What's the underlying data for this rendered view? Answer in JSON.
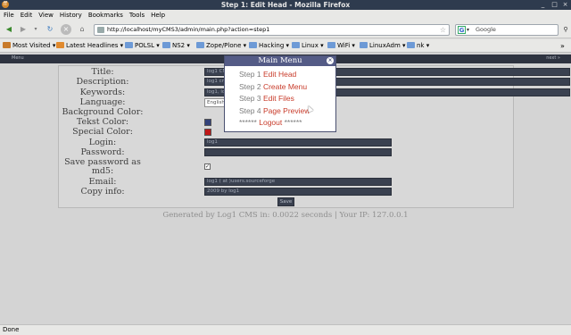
{
  "window": {
    "title": "Step 1: Edit Head - Mozilla Firefox"
  },
  "menu": [
    "File",
    "Edit",
    "View",
    "History",
    "Bookmarks",
    "Tools",
    "Help"
  ],
  "nav": {
    "url": "http://localhost/myCMS3/admin/main.php?action=step1",
    "search_placeholder": "Google"
  },
  "bookmarks": [
    {
      "label": "Most Visited",
      "has_menu": true
    },
    {
      "label": "Latest Headlines",
      "has_menu": true
    },
    {
      "label": "POLSL",
      "has_menu": true
    },
    {
      "label": "NS2",
      "has_menu": true
    },
    {
      "label": "Zope/Plone",
      "has_menu": true
    },
    {
      "label": "Hacking",
      "has_menu": true
    },
    {
      "label": "Linux",
      "has_menu": true
    },
    {
      "label": "WiFi",
      "has_menu": true
    },
    {
      "label": "LinuxAdm",
      "has_menu": true
    },
    {
      "label": "nk",
      "has_menu": true
    }
  ],
  "topstrip": {
    "left": "Menu",
    "right": "next »"
  },
  "form": {
    "labels": {
      "title": "Title:",
      "description": "Description:",
      "keywords": "Keywords:",
      "language": "Language:",
      "background_color": "Background Color:",
      "text_color": "Tekst Color:",
      "special_color": "Special Color:",
      "login": "Login:",
      "password": "Password:",
      "save_password_1": "Save password as",
      "save_password_2": "md5:",
      "email": "Email:",
      "copy_info": "Copy info:"
    },
    "values": {
      "title": "log1 CMS",
      "description": "log1 cms offical page",
      "keywords": "log1, log 1, CMS, content managment system",
      "language": "English",
      "login": "log1",
      "password": "",
      "email": "log1 ( at )users.sourceforge",
      "copy_info": "2009 by log1"
    },
    "save_button": "Save",
    "colors": {
      "text_color": "#33427a",
      "special_color": "#c01818"
    }
  },
  "footer": "Generated by Log1 CMS in: 0.0022 seconds | Your IP: 127.0.0.1",
  "modal": {
    "title": "Main Menu",
    "close_symbol": "×",
    "steps": [
      {
        "prefix": "Step 1",
        "label": "Edit Head"
      },
      {
        "prefix": "Step 2",
        "label": "Create Menu"
      },
      {
        "prefix": "Step 3",
        "label": "Edit Files"
      },
      {
        "prefix": "Step 4",
        "label": "Page Preview"
      }
    ],
    "logout": {
      "stars": "******",
      "label": "Logout"
    }
  },
  "status": "Done"
}
